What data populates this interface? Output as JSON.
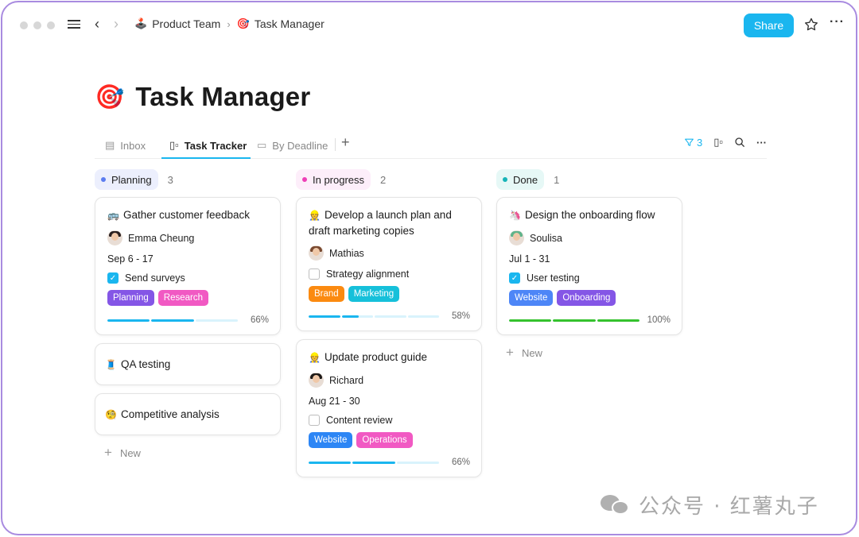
{
  "window": {
    "breadcrumb": [
      {
        "icon": "🕹️",
        "label": "Product Team"
      },
      {
        "icon": "🎯",
        "label": "Task Manager"
      }
    ],
    "share_label": "Share"
  },
  "page": {
    "icon": "🎯",
    "title": "Task Manager"
  },
  "tabs": [
    {
      "icon": "table-icon",
      "glyph": "▤",
      "label": "Inbox",
      "active": false
    },
    {
      "icon": "board-icon",
      "glyph": "▯▫",
      "label": "Task Tracker",
      "active": true
    },
    {
      "icon": "calendar-icon",
      "glyph": "▭",
      "label": "By Deadline",
      "active": false
    }
  ],
  "toolbar": {
    "filter_count": "3",
    "add_view": "+"
  },
  "columns": [
    {
      "name": "Planning",
      "count": "3",
      "pill_bg": "#eceffd",
      "dot_color": "#5b7cf0",
      "cards": [
        {
          "icon": "🚌",
          "title": "Gather customer feedback",
          "assignee": "Emma Cheung",
          "dates": "Sep 6 - 17",
          "checklist": {
            "label": "Send surveys",
            "checked": true
          },
          "tags": [
            {
              "label": "Planning",
              "color": "#8456e6"
            },
            {
              "label": "Research",
              "color": "#f159c3"
            }
          ],
          "progress": {
            "percent": "66%",
            "segments": [
              1,
              1,
              0
            ],
            "color": "#1ab6ef"
          }
        },
        {
          "icon": "🧵",
          "title": "QA testing"
        },
        {
          "icon": "🧐",
          "title": "Competitive analysis"
        }
      ],
      "new_label": "New"
    },
    {
      "name": "In progress",
      "count": "2",
      "pill_bg": "#fdeefa",
      "dot_color": "#ee3fb7",
      "cards": [
        {
          "icon": "👷",
          "title": "Develop a launch plan and draft marketing copies",
          "assignee": "Mathias",
          "checklist": {
            "label": "Strategy alignment",
            "checked": false
          },
          "tags": [
            {
              "label": "Brand",
              "color": "#fb8a10"
            },
            {
              "label": "Marketing",
              "color": "#16c0da"
            }
          ],
          "progress": {
            "percent": "58%",
            "segments": [
              1,
              0.55,
              0,
              0
            ],
            "color": "#1ab6ef"
          }
        },
        {
          "icon": "👷",
          "title": "Update product guide",
          "assignee": "Richard",
          "dates": "Aug 21 - 30",
          "checklist": {
            "label": "Content review",
            "checked": false
          },
          "tags": [
            {
              "label": "Website",
              "color": "#2d86f5"
            },
            {
              "label": "Operations",
              "color": "#f159c3"
            }
          ],
          "progress": {
            "percent": "66%",
            "segments": [
              1,
              1,
              0
            ],
            "color": "#1ab6ef"
          }
        }
      ]
    },
    {
      "name": "Done",
      "count": "1",
      "pill_bg": "#e6f8f6",
      "dot_color": "#16b4b8",
      "cards": [
        {
          "icon": "🦄",
          "title": "Design the onboarding flow",
          "assignee": "Soulisa",
          "dates": "Jul 1 - 31",
          "checklist": {
            "label": "User testing",
            "checked": true
          },
          "tags": [
            {
              "label": "Website",
              "color": "#4d86f7"
            },
            {
              "label": "Onboarding",
              "color": "#8456e6"
            }
          ],
          "progress": {
            "percent": "100%",
            "segments": [
              1,
              1,
              1
            ],
            "color": "#35c22e"
          }
        }
      ],
      "new_label": "New"
    }
  ],
  "watermark": "公众号 · 红薯丸子"
}
